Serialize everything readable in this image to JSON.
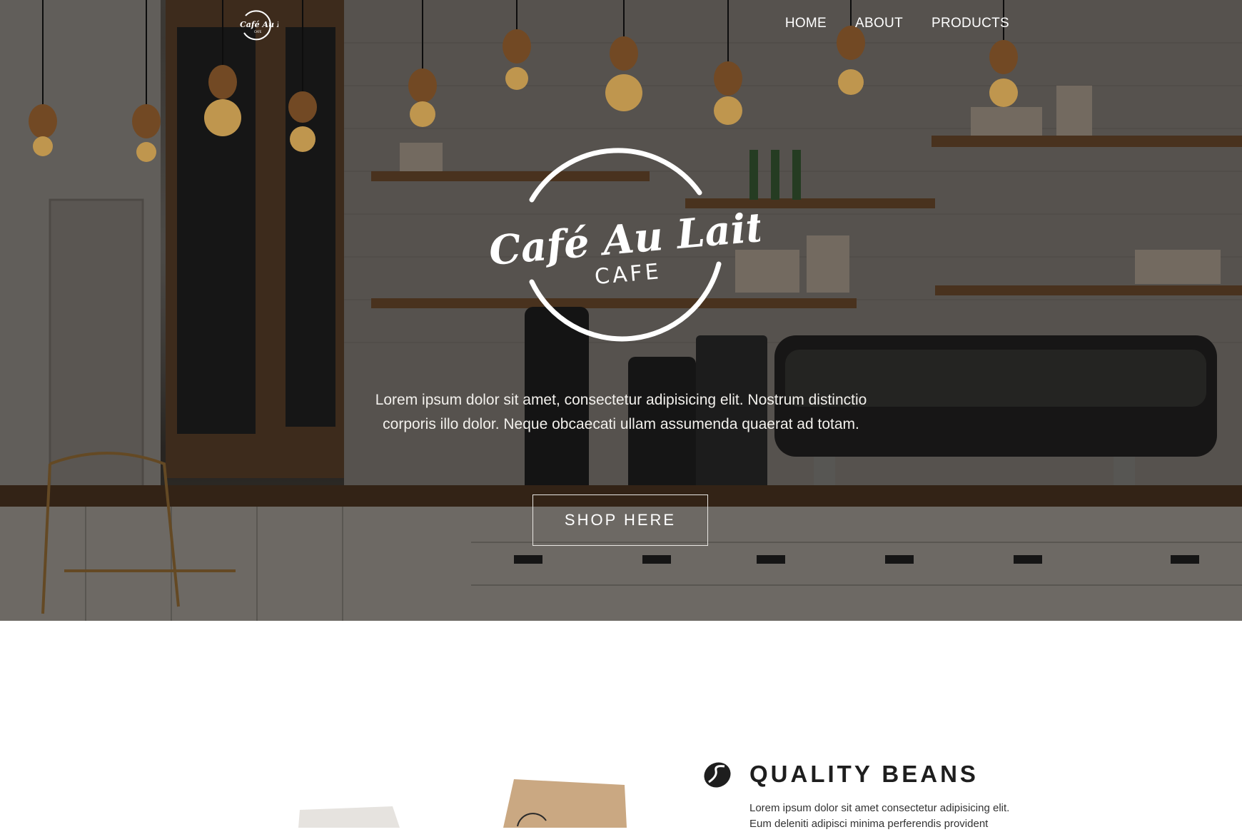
{
  "brand": {
    "name": "Café Au Lait",
    "tagline": "CAFE",
    "logo_small_icon": "cafe-au-lait-logo-icon"
  },
  "nav": {
    "items": [
      {
        "label": "HOME"
      },
      {
        "label": "ABOUT"
      },
      {
        "label": "PRODUCTS"
      }
    ]
  },
  "hero": {
    "text_line1": "Lorem ipsum dolor sit amet, consectetur adipisicing elit. Nostrum distinctio",
    "text_line2": "corporis illo dolor. Neque obcaecati ullam assumenda quaerat ad totam.",
    "cta_label": "SHOP HERE",
    "background": "coffee-shop-interior-photo"
  },
  "feature": {
    "icon": "coffee-bean-icon",
    "title": "QUALITY BEANS",
    "text_line1": "Lorem ipsum dolor sit amet consectetur adipisicing elit.",
    "text_line2": "Eum deleniti adipisci minima perferendis provident"
  },
  "colors": {
    "hero_text": "#f2f0ec",
    "white": "#ffffff",
    "heading": "#1e1e1e",
    "body_text": "#333333"
  }
}
